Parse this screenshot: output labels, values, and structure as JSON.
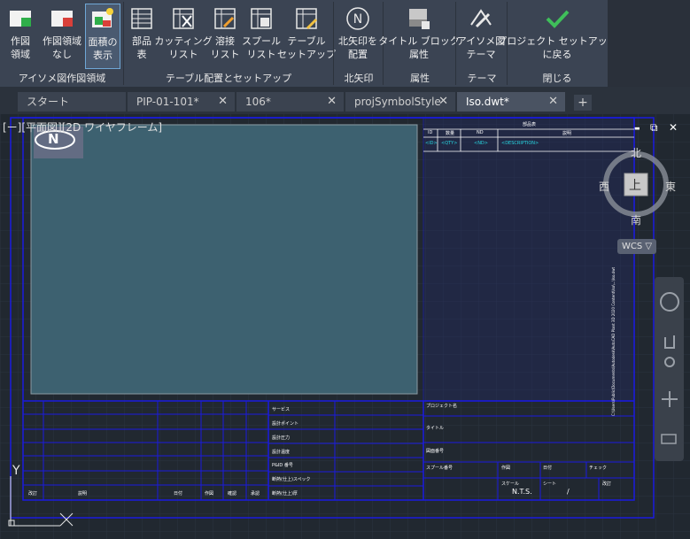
{
  "ribbon": {
    "buttons": [
      {
        "id": "create",
        "label": "作図\n領域"
      },
      {
        "id": "none",
        "label": "作図領域\nなし"
      },
      {
        "id": "show",
        "label": "面積の\n表示"
      },
      {
        "id": "parts",
        "label": "部品\n表"
      },
      {
        "id": "cutting",
        "label": "カッティング\nリスト"
      },
      {
        "id": "weld",
        "label": "溶接\nリスト"
      },
      {
        "id": "spool",
        "label": "スプール\nリスト"
      },
      {
        "id": "tablesetup",
        "label": "テーブル\nセットアップ"
      },
      {
        "id": "north",
        "label": "北矢印を\n配置"
      },
      {
        "id": "titleblock",
        "label": "タイトル ブロック\n属性"
      },
      {
        "id": "theme",
        "label": "アイソメ図\nテーマ"
      },
      {
        "id": "return",
        "label": "プロジェクト セットアップ\nに戻る"
      }
    ],
    "panels": [
      "アイソメ図作図領域",
      "テーブル配置とセットアップ",
      "北矢印",
      "属性",
      "テーマ",
      "閉じる"
    ]
  },
  "tabs": [
    {
      "label": "スタート"
    },
    {
      "label": "PIP-01-101*"
    },
    {
      "label": "106*"
    },
    {
      "label": "projSymbolStyle"
    },
    {
      "label": "Iso.dwt*"
    }
  ],
  "tab_add": "+",
  "viewport_label": "[ー][平面図][2D ワイヤフレーム]",
  "window_controls": {
    "minimize": "▬",
    "restore": "⧉",
    "close": "✕"
  },
  "viewcube": {
    "top": "上",
    "north": "北",
    "south": "南",
    "east": "東",
    "west": "西"
  },
  "wcs": "WCS ▽",
  "north_arrow": "N",
  "drawing": {
    "bom_title": "部品表",
    "bom_headers": [
      "ID",
      "数量",
      "ND",
      "説明"
    ],
    "bom_row": [
      "<ID>",
      "<QTY>",
      "<ND>",
      "<DESCRIPTION>"
    ],
    "tb_left_labels": [
      "サービス",
      "設計ポイント",
      "設計圧力",
      "設計温度",
      "P&ID 番号",
      "断熱(仕上)スペック",
      "断熱(仕上)厚"
    ],
    "tb_bottom_headers": [
      "改訂",
      "説明",
      "日付",
      "作図",
      "確認",
      "承認"
    ],
    "tb_right_labels": [
      "プロジェクト名",
      "タイトル",
      "図面番号",
      "スプール番号",
      "作図",
      "日付",
      "スケール",
      "チェック",
      "シート",
      "改訂"
    ],
    "scale": "N.T.S.",
    "sheet": "/",
    "side_text": "C:\\Users\\Public\\Documents\\Autodesk\\AutoCAD Plant 3D 2020 Content\\Iso\\...\\Iso.dwt"
  },
  "ucs": {
    "y": "Y",
    "x": "X"
  },
  "colors": {
    "ribbon_bg": "#3b4453",
    "canvas_bg": "#212830",
    "border_blue": "#1a1ae0",
    "area_fill": "#3d6170",
    "check_green": "#3fbf5a"
  }
}
